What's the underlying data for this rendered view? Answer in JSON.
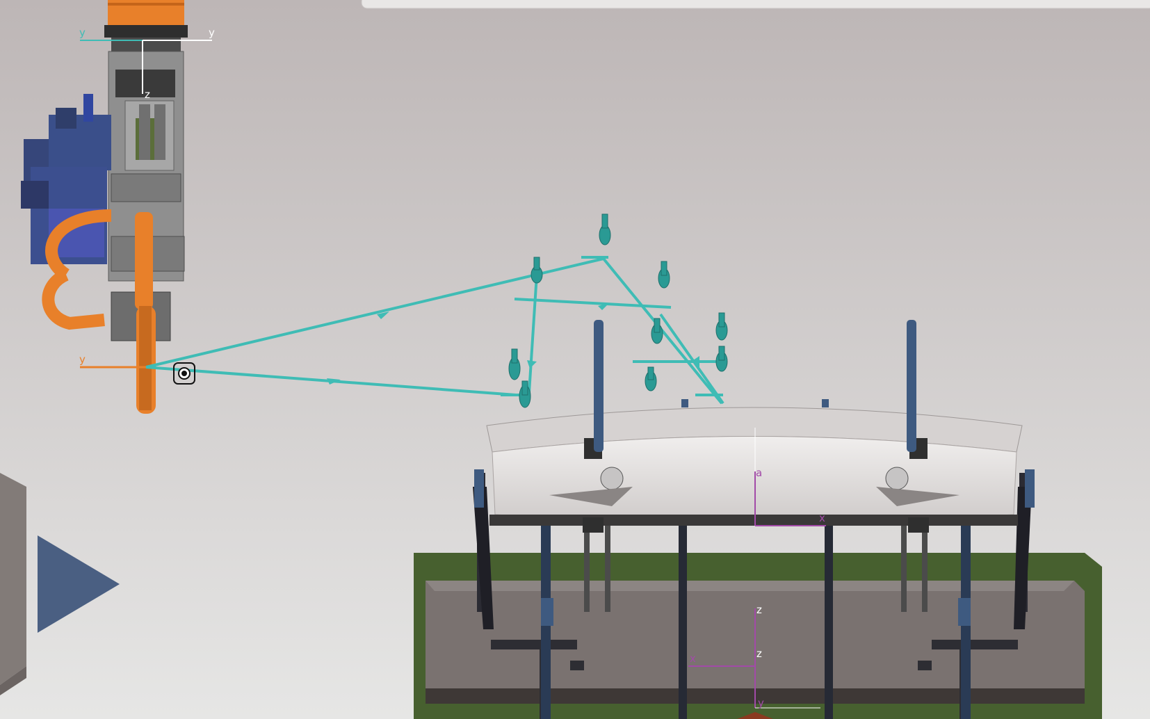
{
  "viewport": {
    "colors": {
      "background_top": "#bdb6b6",
      "background_bottom": "#e6e6e5",
      "robot_orange": "#e8802a",
      "robot_grey": "#8f8f8f",
      "robot_dark": "#3a3a3a",
      "servo_blue": "#3a4f8a",
      "path_teal": "#3fbcb5",
      "fixture_white": "#e3e1e0",
      "fixture_green": "#47602f",
      "base_plate": "#7a7270",
      "clamp_blue": "#3e5a80",
      "frame_magenta": "#a24aa8",
      "play_blue": "#4a5f82"
    }
  },
  "robot": {
    "top_frame": {
      "left_axis": "y",
      "right_axis": "y",
      "down_axis": "z"
    },
    "tcp_frame": {
      "axis": "y"
    }
  },
  "fixture": {
    "frame": {
      "upper_axis": "a",
      "right_axis": "x"
    }
  },
  "base": {
    "frame": {
      "top_axis": "z",
      "middle_axis": "z",
      "left_axis": "x",
      "bottom_axis": "y"
    }
  },
  "play_button": {
    "icon": "play-icon"
  }
}
